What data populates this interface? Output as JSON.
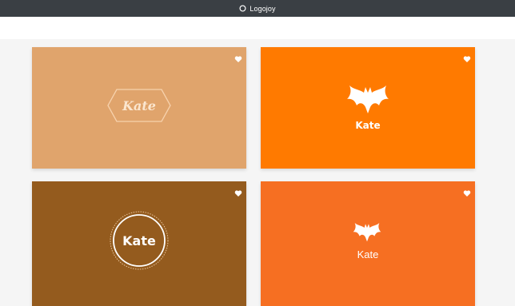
{
  "app": {
    "brand": "Logojoy"
  },
  "colors": {
    "topbar": "#3a3f44",
    "card1_bg": "#e0a46c",
    "card2_bg": "#ff7a00",
    "card3_bg": "#945b1e",
    "card4_bg": "#f66f22"
  },
  "cards": [
    {
      "name": "Kate",
      "style": "hexagon-badge",
      "favorite_icon": "heart-icon"
    },
    {
      "name": "Kate",
      "style": "bat-icon-bold",
      "favorite_icon": "heart-icon"
    },
    {
      "name": "Kate",
      "style": "circle-badge",
      "favorite_icon": "heart-icon"
    },
    {
      "name": "Kate",
      "style": "bat-icon-light",
      "favorite_icon": "heart-icon"
    }
  ]
}
